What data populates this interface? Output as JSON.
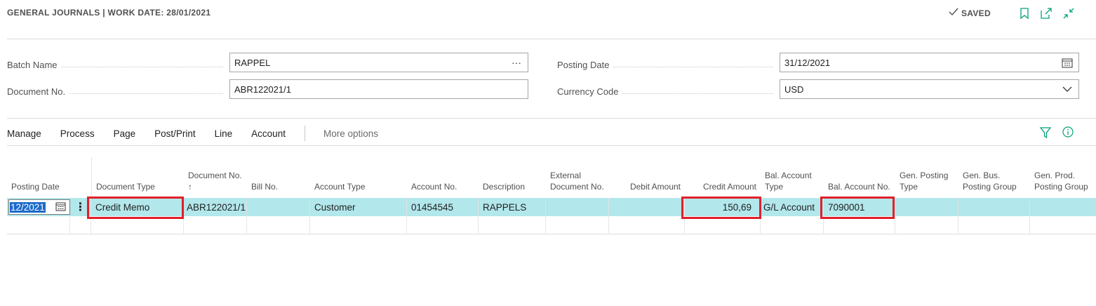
{
  "header": {
    "title": "GENERAL JOURNALS | WORK DATE: 28/01/2021",
    "saved_label": "SAVED"
  },
  "fields": {
    "batch_name": {
      "label": "Batch Name",
      "value": "RAPPEL"
    },
    "document_no": {
      "label": "Document No.",
      "value": "ABR122021/1"
    },
    "posting_date": {
      "label": "Posting Date",
      "value": "31/12/2021"
    },
    "currency_code": {
      "label": "Currency Code",
      "value": "USD"
    }
  },
  "actions": {
    "manage": "Manage",
    "process": "Process",
    "page": "Page",
    "post_print": "Post/Print",
    "line": "Line",
    "account": "Account",
    "more_options": "More options"
  },
  "columns": {
    "posting_date": "Posting Date",
    "document_type": "Document Type",
    "document_no": "Document No. ↑",
    "bill_no": "Bill No.",
    "account_type": "Account Type",
    "account_no": "Account No.",
    "description": "Description",
    "external_document_no": "External Document No.",
    "debit_amount": "Debit Amount",
    "credit_amount": "Credit Amount",
    "bal_account_type": "Bal. Account Type",
    "bal_account_no": "Bal. Account No.",
    "gen_posting_type": "Gen. Posting Type",
    "gen_bus_posting_group": "Gen. Bus. Posting Group",
    "gen_prod_posting_group": "Gen. Prod. Posting Group"
  },
  "rows": [
    {
      "posting_date": "12/2021",
      "document_type": "Credit Memo",
      "document_no": "ABR122021/1",
      "bill_no": "",
      "account_type": "Customer",
      "account_no": "01454545",
      "description": "RAPPELS",
      "external_document_no": "",
      "debit_amount": "",
      "credit_amount": "150,69",
      "bal_account_type": "G/L Account",
      "bal_account_no": "7090001",
      "gen_posting_type": "",
      "gen_bus_posting_group": "",
      "gen_prod_posting_group": ""
    }
  ],
  "colors": {
    "selected_row": "#b2e7eb",
    "highlight_box": "#e0202a",
    "accent": "#00a37a",
    "selection": "#1b6ac9"
  },
  "icons": [
    "checkmark-icon",
    "bookmark-icon",
    "open-new-window-icon",
    "collapse-icon",
    "ellipsis-icon",
    "calendar-icon",
    "chevron-down-icon",
    "filter-icon",
    "info-icon",
    "row-menu-icon"
  ]
}
